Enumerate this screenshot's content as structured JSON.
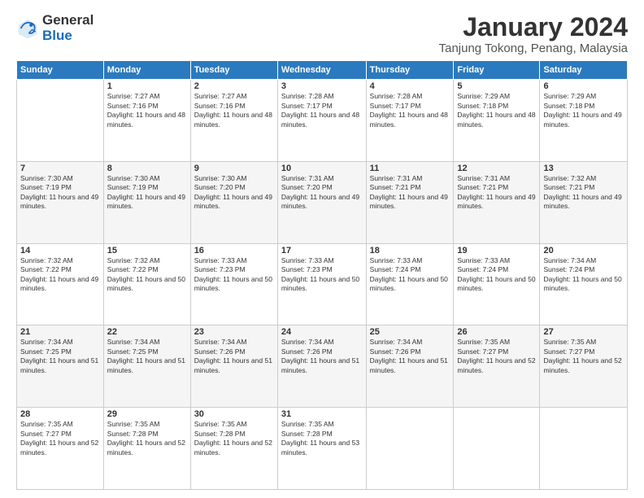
{
  "logo": {
    "general": "General",
    "blue": "Blue"
  },
  "title": "January 2024",
  "subtitle": "Tanjung Tokong, Penang, Malaysia",
  "header_days": [
    "Sunday",
    "Monday",
    "Tuesday",
    "Wednesday",
    "Thursday",
    "Friday",
    "Saturday"
  ],
  "weeks": [
    [
      {
        "day": "",
        "info": ""
      },
      {
        "day": "1",
        "info": "Sunrise: 7:27 AM\nSunset: 7:16 PM\nDaylight: 11 hours and 48 minutes."
      },
      {
        "day": "2",
        "info": "Sunrise: 7:27 AM\nSunset: 7:16 PM\nDaylight: 11 hours and 48 minutes."
      },
      {
        "day": "3",
        "info": "Sunrise: 7:28 AM\nSunset: 7:17 PM\nDaylight: 11 hours and 48 minutes."
      },
      {
        "day": "4",
        "info": "Sunrise: 7:28 AM\nSunset: 7:17 PM\nDaylight: 11 hours and 48 minutes."
      },
      {
        "day": "5",
        "info": "Sunrise: 7:29 AM\nSunset: 7:18 PM\nDaylight: 11 hours and 48 minutes."
      },
      {
        "day": "6",
        "info": "Sunrise: 7:29 AM\nSunset: 7:18 PM\nDaylight: 11 hours and 49 minutes."
      }
    ],
    [
      {
        "day": "7",
        "info": "Sunrise: 7:30 AM\nSunset: 7:19 PM\nDaylight: 11 hours and 49 minutes."
      },
      {
        "day": "8",
        "info": "Sunrise: 7:30 AM\nSunset: 7:19 PM\nDaylight: 11 hours and 49 minutes."
      },
      {
        "day": "9",
        "info": "Sunrise: 7:30 AM\nSunset: 7:20 PM\nDaylight: 11 hours and 49 minutes."
      },
      {
        "day": "10",
        "info": "Sunrise: 7:31 AM\nSunset: 7:20 PM\nDaylight: 11 hours and 49 minutes."
      },
      {
        "day": "11",
        "info": "Sunrise: 7:31 AM\nSunset: 7:21 PM\nDaylight: 11 hours and 49 minutes."
      },
      {
        "day": "12",
        "info": "Sunrise: 7:31 AM\nSunset: 7:21 PM\nDaylight: 11 hours and 49 minutes."
      },
      {
        "day": "13",
        "info": "Sunrise: 7:32 AM\nSunset: 7:21 PM\nDaylight: 11 hours and 49 minutes."
      }
    ],
    [
      {
        "day": "14",
        "info": "Sunrise: 7:32 AM\nSunset: 7:22 PM\nDaylight: 11 hours and 49 minutes."
      },
      {
        "day": "15",
        "info": "Sunrise: 7:32 AM\nSunset: 7:22 PM\nDaylight: 11 hours and 50 minutes."
      },
      {
        "day": "16",
        "info": "Sunrise: 7:33 AM\nSunset: 7:23 PM\nDaylight: 11 hours and 50 minutes."
      },
      {
        "day": "17",
        "info": "Sunrise: 7:33 AM\nSunset: 7:23 PM\nDaylight: 11 hours and 50 minutes."
      },
      {
        "day": "18",
        "info": "Sunrise: 7:33 AM\nSunset: 7:24 PM\nDaylight: 11 hours and 50 minutes."
      },
      {
        "day": "19",
        "info": "Sunrise: 7:33 AM\nSunset: 7:24 PM\nDaylight: 11 hours and 50 minutes."
      },
      {
        "day": "20",
        "info": "Sunrise: 7:34 AM\nSunset: 7:24 PM\nDaylight: 11 hours and 50 minutes."
      }
    ],
    [
      {
        "day": "21",
        "info": "Sunrise: 7:34 AM\nSunset: 7:25 PM\nDaylight: 11 hours and 51 minutes."
      },
      {
        "day": "22",
        "info": "Sunrise: 7:34 AM\nSunset: 7:25 PM\nDaylight: 11 hours and 51 minutes."
      },
      {
        "day": "23",
        "info": "Sunrise: 7:34 AM\nSunset: 7:26 PM\nDaylight: 11 hours and 51 minutes."
      },
      {
        "day": "24",
        "info": "Sunrise: 7:34 AM\nSunset: 7:26 PM\nDaylight: 11 hours and 51 minutes."
      },
      {
        "day": "25",
        "info": "Sunrise: 7:34 AM\nSunset: 7:26 PM\nDaylight: 11 hours and 51 minutes."
      },
      {
        "day": "26",
        "info": "Sunrise: 7:35 AM\nSunset: 7:27 PM\nDaylight: 11 hours and 52 minutes."
      },
      {
        "day": "27",
        "info": "Sunrise: 7:35 AM\nSunset: 7:27 PM\nDaylight: 11 hours and 52 minutes."
      }
    ],
    [
      {
        "day": "28",
        "info": "Sunrise: 7:35 AM\nSunset: 7:27 PM\nDaylight: 11 hours and 52 minutes."
      },
      {
        "day": "29",
        "info": "Sunrise: 7:35 AM\nSunset: 7:28 PM\nDaylight: 11 hours and 52 minutes."
      },
      {
        "day": "30",
        "info": "Sunrise: 7:35 AM\nSunset: 7:28 PM\nDaylight: 11 hours and 52 minutes."
      },
      {
        "day": "31",
        "info": "Sunrise: 7:35 AM\nSunset: 7:28 PM\nDaylight: 11 hours and 53 minutes."
      },
      {
        "day": "",
        "info": ""
      },
      {
        "day": "",
        "info": ""
      },
      {
        "day": "",
        "info": ""
      }
    ]
  ]
}
